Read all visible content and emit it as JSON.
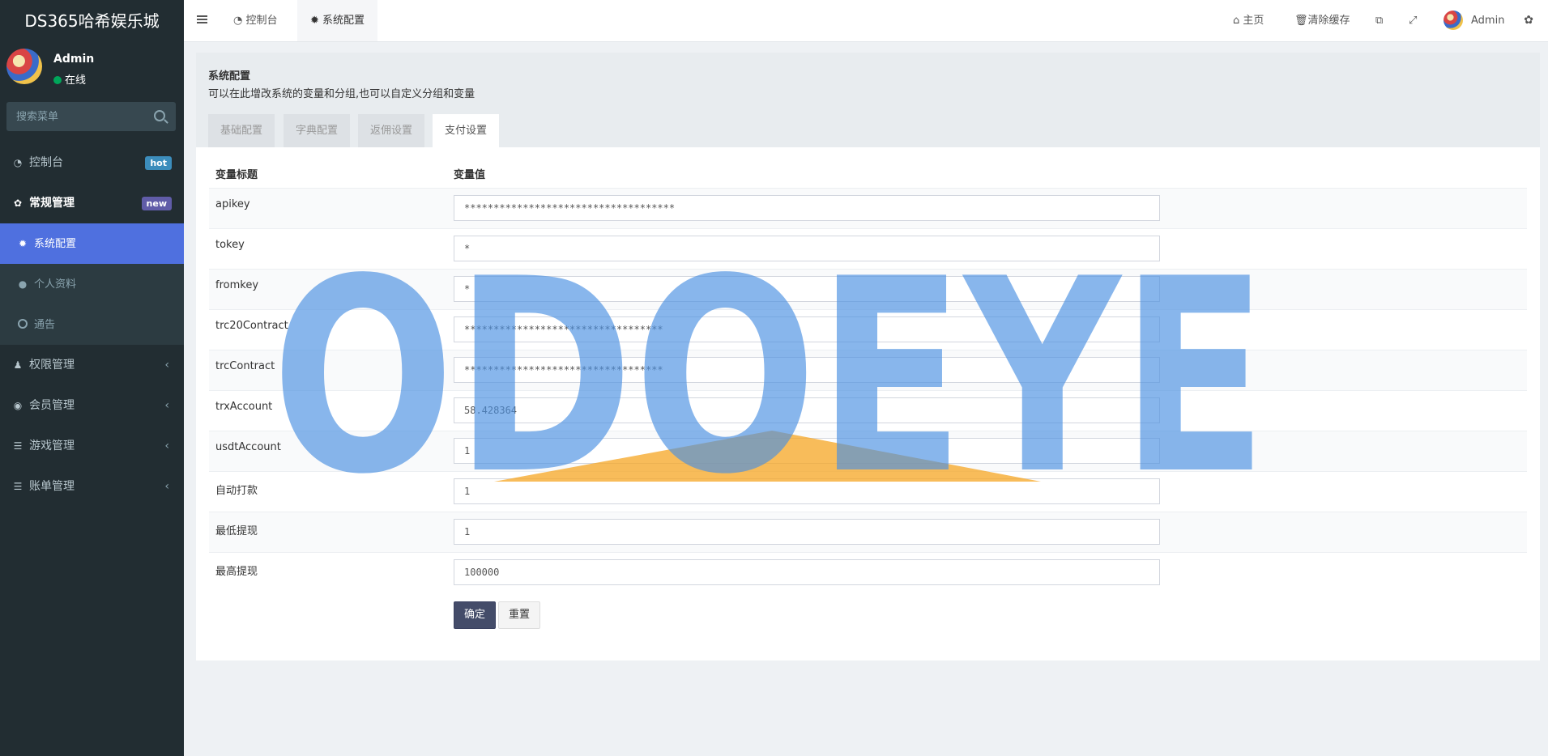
{
  "brand": "DS365哈希娱乐城",
  "user": {
    "name": "Admin",
    "status": "在线"
  },
  "search": {
    "placeholder": "搜索菜单"
  },
  "menu": {
    "dashboard": {
      "label": "控制台",
      "badge": "hot",
      "badge_color": "#3c8dbc"
    },
    "general": {
      "label": "常规管理",
      "badge": "new",
      "badge_color": "#605ca8"
    },
    "sub": {
      "system": "系统配置",
      "profile": "个人资料",
      "notice": "通告"
    },
    "auth": "权限管理",
    "member": "会员管理",
    "game": "游戏管理",
    "bill": "账单管理"
  },
  "header": {
    "tabs": [
      "控制台",
      "系统配置"
    ],
    "home": "主页",
    "clear_cache": "清除缓存",
    "user": "Admin"
  },
  "panel": {
    "title": "系统配置",
    "desc": "可以在此增改系统的变量和分组,也可以自定义分组和变量",
    "tabs": [
      "基础配置",
      "字典配置",
      "返佣设置",
      "支付设置"
    ],
    "col_title": "变量标题",
    "col_value": "变量值",
    "rows": [
      {
        "label": "apikey",
        "value": "************************************"
      },
      {
        "label": "tokey",
        "value": "*"
      },
      {
        "label": "fromkey",
        "value": "*"
      },
      {
        "label": "trc20Contract",
        "value": "**********************************"
      },
      {
        "label": "trcContract",
        "value": "**********************************"
      },
      {
        "label": "trxAccount",
        "value": "58.428364"
      },
      {
        "label": "usdtAccount",
        "value": "1"
      },
      {
        "label": "自动打款",
        "value": "1"
      },
      {
        "label": "最低提现",
        "value": "1"
      },
      {
        "label": "最高提现",
        "value": "100000"
      }
    ],
    "submit": "确定",
    "reset": "重置"
  },
  "watermark": "ODOEYE",
  "colors": {
    "sidebar": "#222d32",
    "active": "#4f70df",
    "watermark_blue": "#4a90e2",
    "watermark_orange": "#f5a623"
  }
}
